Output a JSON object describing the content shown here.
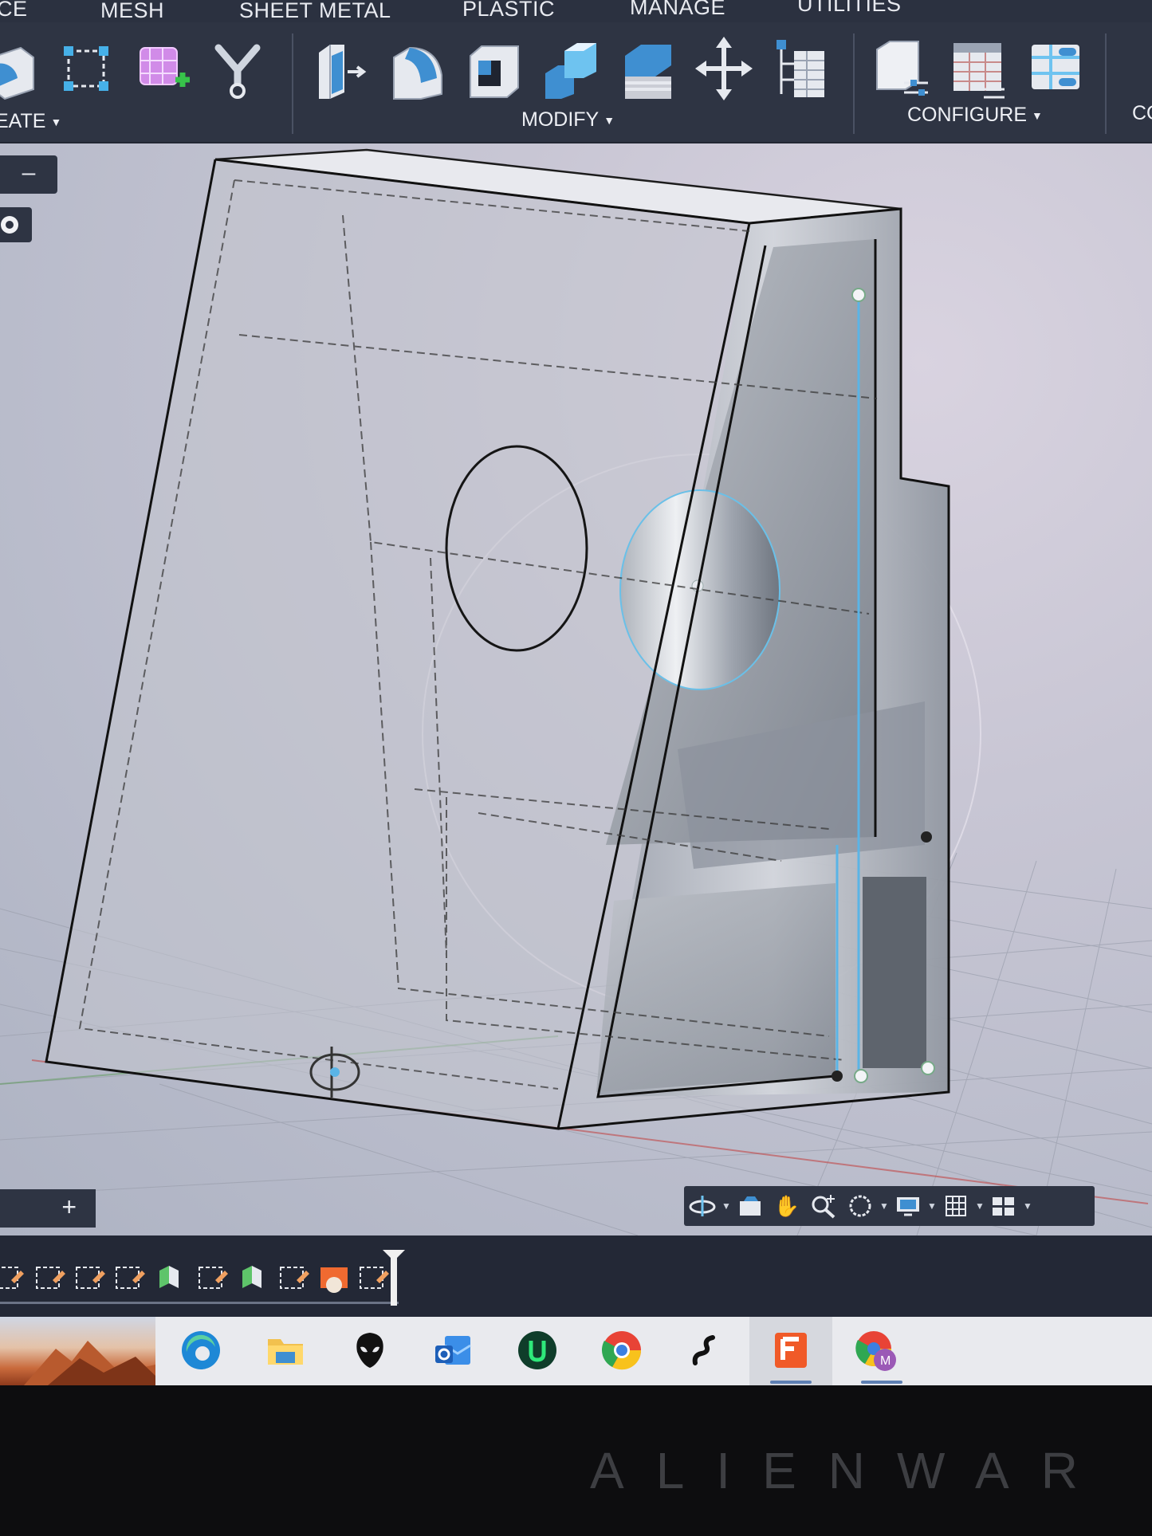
{
  "menu_tabs": [
    "CE",
    "MESH",
    "SHEET METAL",
    "PLASTIC",
    "MANAGE",
    "UTILITIES"
  ],
  "ribbon": {
    "groups": [
      {
        "label": "EATE"
      },
      {
        "label": "MODIFY"
      },
      {
        "label": "CONFIGURE"
      },
      {
        "label": "CO"
      }
    ]
  },
  "viewport": {
    "browser_collapse_label": "–",
    "comments_add_label": "+"
  },
  "navbar": {
    "icons": [
      "orbit-icon",
      "look-at-icon",
      "pan-icon",
      "zoom-icon",
      "fit-icon",
      "display-settings-icon",
      "grid-icon",
      "viewports-icon"
    ]
  },
  "taskbar": {
    "apps": [
      "edge-icon",
      "file-explorer-icon",
      "alienware-icon",
      "outlook-icon",
      "u-app-icon",
      "chrome-icon",
      "snapdragon-icon",
      "fusion-icon",
      "chrome-profile-icon"
    ]
  },
  "bezel": {
    "brand": "ALIENWAR"
  },
  "colors": {
    "ribbon_bg": "#2e3443",
    "menu_bg": "#2b3140",
    "timeline_bg": "#232836",
    "taskbar_bg": "#e9eaee",
    "selection_blue": "#5ab4e6",
    "fusion_orange": "#f05a28"
  }
}
